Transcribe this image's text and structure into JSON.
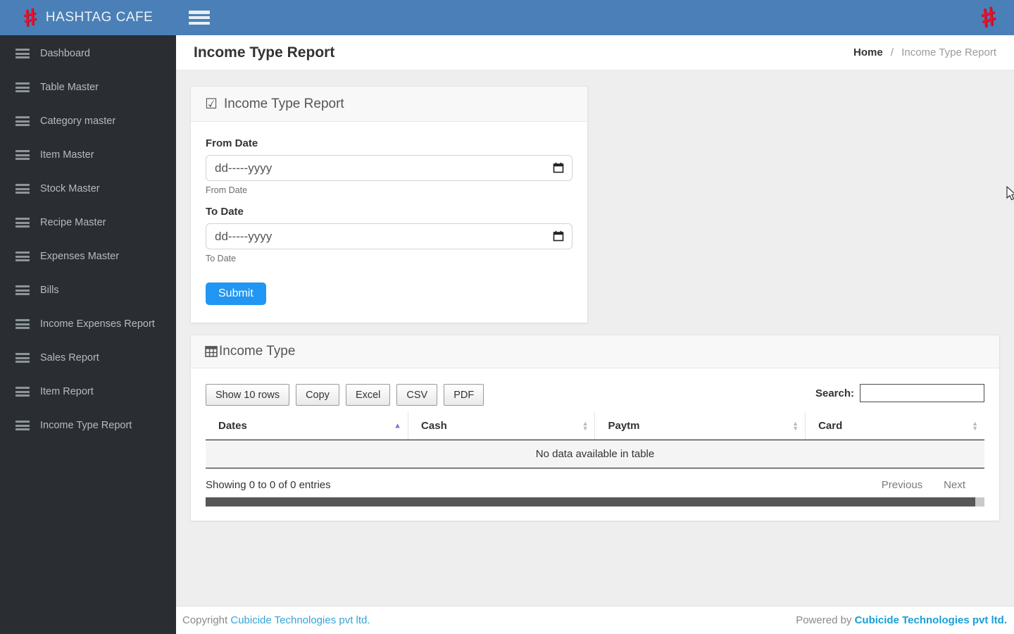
{
  "icons": {
    "hashtag": "#",
    "check": "☑",
    "sort_up": "▲",
    "sort_down": "▼"
  },
  "colors": {
    "topbar": "#4a80b7",
    "sidebar": "#2a2e33",
    "brand_red": "#e8112d",
    "submit_blue": "#2196f3",
    "link_blue": "#189fd8"
  },
  "topbar": {
    "brand": "HASHTAG CAFE"
  },
  "sidebar": {
    "items": [
      {
        "label": "Dashboard"
      },
      {
        "label": "Table Master"
      },
      {
        "label": "Category master"
      },
      {
        "label": "Item Master"
      },
      {
        "label": "Stock Master"
      },
      {
        "label": "Recipe Master"
      },
      {
        "label": "Expenses Master"
      },
      {
        "label": "Bills"
      },
      {
        "label": "Income Expenses Report"
      },
      {
        "label": "Sales Report"
      },
      {
        "label": "Item Report"
      },
      {
        "label": "Income Type Report"
      }
    ]
  },
  "page": {
    "title": "Income Type Report",
    "breadcrumb": {
      "home": "Home",
      "separator": "/",
      "current": "Income Type Report"
    }
  },
  "filter_card": {
    "title": "Income Type Report",
    "from": {
      "label": "From Date",
      "placeholder": "dd-----yyyy",
      "helper": "From Date"
    },
    "to": {
      "label": "To Date",
      "placeholder": "dd-----yyyy",
      "helper": "To Date"
    },
    "submit_label": "Submit"
  },
  "table_card": {
    "title": "Income Type",
    "buttons": [
      "Show 10 rows",
      "Copy",
      "Excel",
      "CSV",
      "PDF"
    ],
    "search": {
      "label": "Search:",
      "value": ""
    },
    "columns": [
      {
        "label": "Dates",
        "sort": "asc"
      },
      {
        "label": "Cash",
        "sort": "none"
      },
      {
        "label": "Paytm",
        "sort": "none"
      },
      {
        "label": "Card",
        "sort": "none"
      }
    ],
    "empty_text": "No data available in table",
    "info_text": "Showing 0 to 0 of 0 entries",
    "pagination": {
      "previous": "Previous",
      "next": "Next"
    }
  },
  "footer": {
    "copyright_prefix": "Copyright",
    "copyright_link": "Cubicide Technologies pvt ltd.",
    "powered_prefix": "Powered by",
    "powered_link": "Cubicide Technologies pvt ltd."
  }
}
